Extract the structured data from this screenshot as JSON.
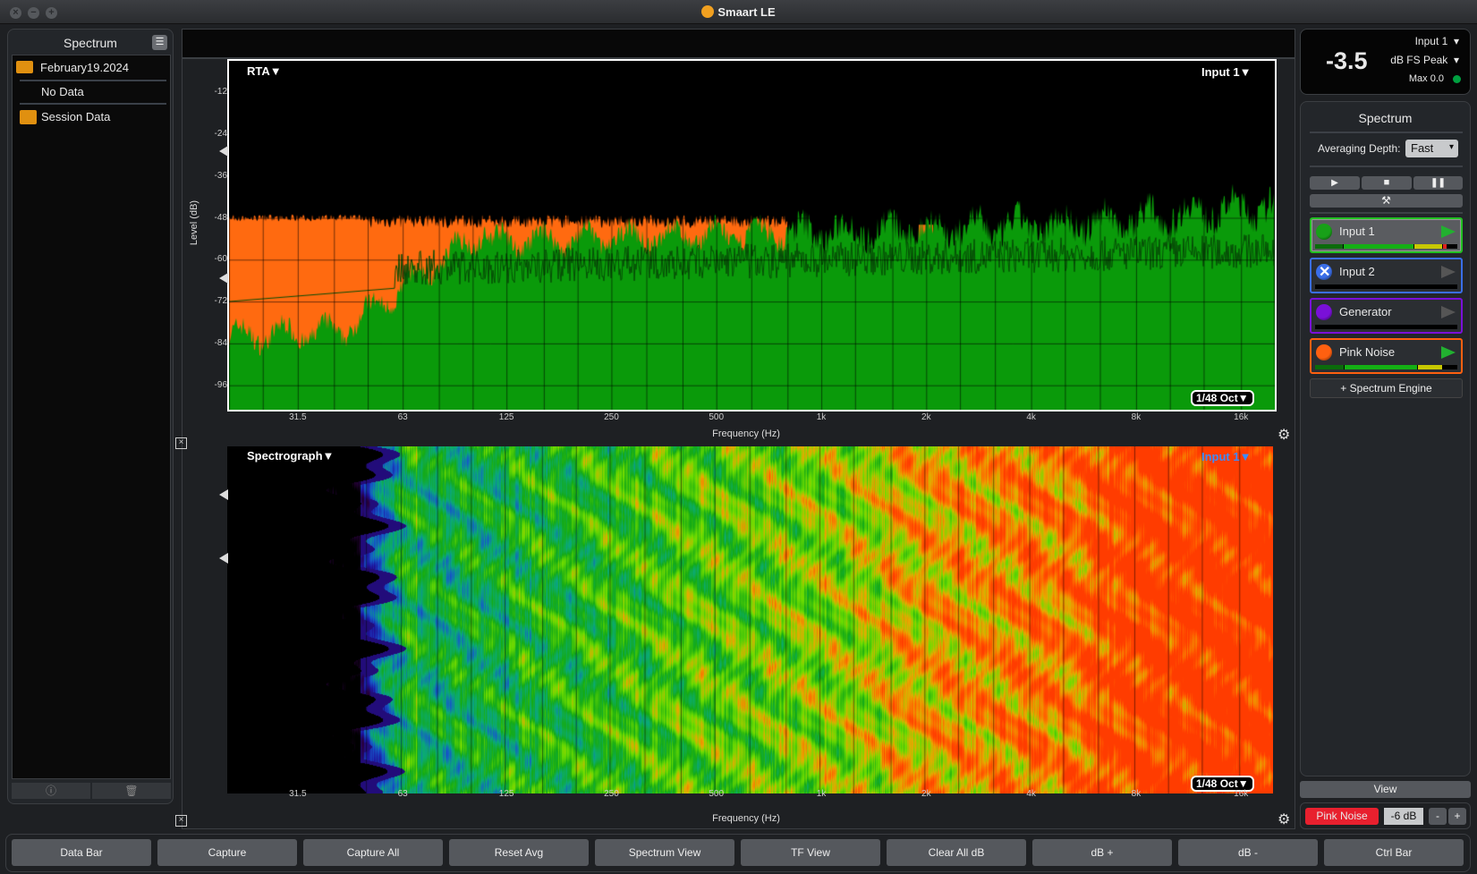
{
  "window": {
    "title": "Smaart LE"
  },
  "sidebar": {
    "title": "Spectrum",
    "items": [
      {
        "label": "February19.2024",
        "type": "folder-open"
      },
      {
        "label": "No Data",
        "type": "item"
      },
      {
        "label": "Session Data",
        "type": "folder"
      }
    ]
  },
  "rta": {
    "mode_label": "RTA▼",
    "input_label": "Input 1▼",
    "resolution_label": "1/48 Oct▼",
    "ylabel": "Level (dB)",
    "xlabel": "Frequency (Hz)"
  },
  "spectrograph": {
    "mode_label": "Spectrograph▼",
    "input_label": "Input 1▼",
    "resolution_label": "1/48 Oct▼",
    "xlabel": "Frequency (Hz)"
  },
  "chart_data": {
    "type": "area",
    "xlabel": "Frequency (Hz)",
    "ylabel": "Level (dB)",
    "xscale": "log",
    "xlim": [
      20,
      20000
    ],
    "ylim": [
      -103,
      -3
    ],
    "x_ticks": [
      "31.5",
      "63",
      "125",
      "250",
      "500",
      "1k",
      "2k",
      "4k",
      "8k",
      "16k"
    ],
    "y_ticks": [
      "-12",
      "-24",
      "-36",
      "-48",
      "-60",
      "-72",
      "-84",
      "-96"
    ],
    "grid": true,
    "colors": {
      "live": "#0a9a0a",
      "reference": "#ff6a10",
      "trace": "#064d06"
    }
  },
  "meter": {
    "value": "-3.5",
    "input": "Input 1",
    "units": "dB FS Peak",
    "max": "Max 0.0",
    "max_color": "#00a040"
  },
  "spectrum_panel": {
    "title": "Spectrum",
    "averaging_label": "Averaging Depth:",
    "averaging_value": "Fast",
    "engines": [
      {
        "name": "Input 1",
        "color": "#18a018",
        "border": "#22c022",
        "active": true,
        "level": 0.95
      },
      {
        "name": "Input 2",
        "color": "#3a6ee8",
        "border": "#3a6ee8",
        "active": false,
        "level": 0
      },
      {
        "name": "Generator",
        "color": "#7a10d8",
        "border": "#7a10d8",
        "active": false,
        "level": 0
      },
      {
        "name": "Pink Noise",
        "color": "#ff6010",
        "border": "#ff6010",
        "active": true,
        "level": 0.88
      }
    ],
    "add_engine": "+ Spectrum Engine"
  },
  "view_label": "View",
  "generator": {
    "label": "Pink Noise",
    "level": "-6 dB",
    "minus": "-",
    "plus": "+"
  },
  "bottom_buttons": [
    "Data Bar",
    "Capture",
    "Capture All",
    "Reset Avg",
    "Spectrum View",
    "TF View",
    "Clear All dB",
    "dB +",
    "dB -",
    "Ctrl Bar"
  ]
}
